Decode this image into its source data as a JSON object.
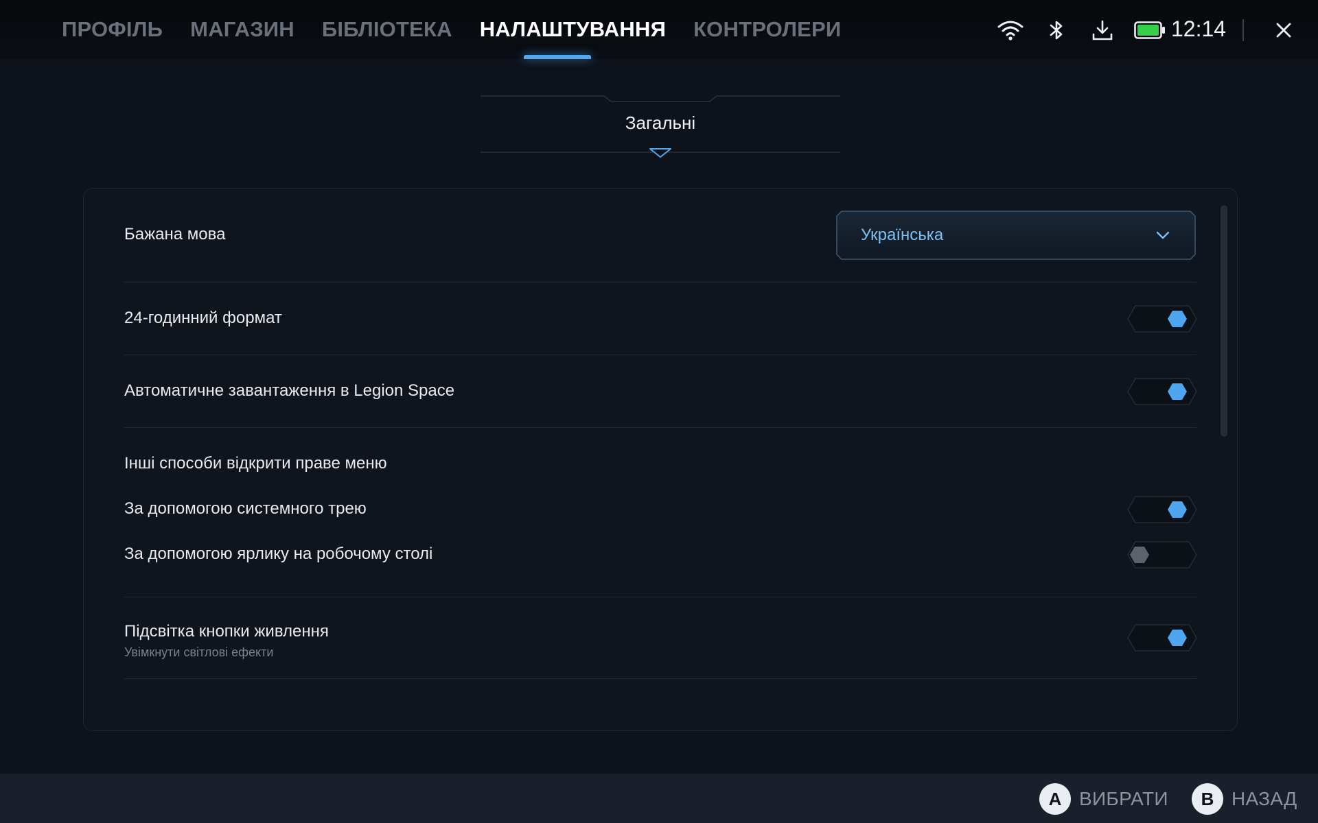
{
  "nav": {
    "tabs": [
      {
        "label": "ПРОФІЛЬ",
        "active": false
      },
      {
        "label": "МАГАЗИН",
        "active": false
      },
      {
        "label": "БІБЛІОТЕКА",
        "active": false
      },
      {
        "label": "НАЛАШТУВАННЯ",
        "active": true
      },
      {
        "label": "КОНТРОЛЕРИ",
        "active": false
      }
    ]
  },
  "status": {
    "icons": [
      "wifi-icon",
      "bluetooth-icon",
      "download-icon",
      "battery-icon",
      "close-icon"
    ],
    "time": "12:14",
    "battery_color": "#34d049"
  },
  "section": {
    "title": "Загальні"
  },
  "settings": {
    "language": {
      "label": "Бажана мова",
      "value": "Українська"
    },
    "format24": {
      "label": "24-годинний формат",
      "on": true
    },
    "autostart": {
      "label": "Автоматичне завантаження в Legion Space",
      "on": true
    },
    "right_menu": {
      "heading": "Інші способи відкрити праве меню",
      "tray": {
        "label": "За допомогою системного трею",
        "on": true
      },
      "shortcut": {
        "label": "За допомогою ярлику на робочому столі",
        "on": false
      }
    },
    "power_light": {
      "label": "Підсвітка кнопки живлення",
      "sublabel": "Увімкнути світлові ефекти",
      "on": true
    }
  },
  "footer": {
    "select": {
      "key": "A",
      "label": "ВИБРАТИ"
    },
    "back": {
      "key": "B",
      "label": "НАЗАД"
    }
  },
  "colors": {
    "accent": "#4fa8ef",
    "toggle_on": "#4ea6f0",
    "toggle_off": "#5d636c"
  }
}
